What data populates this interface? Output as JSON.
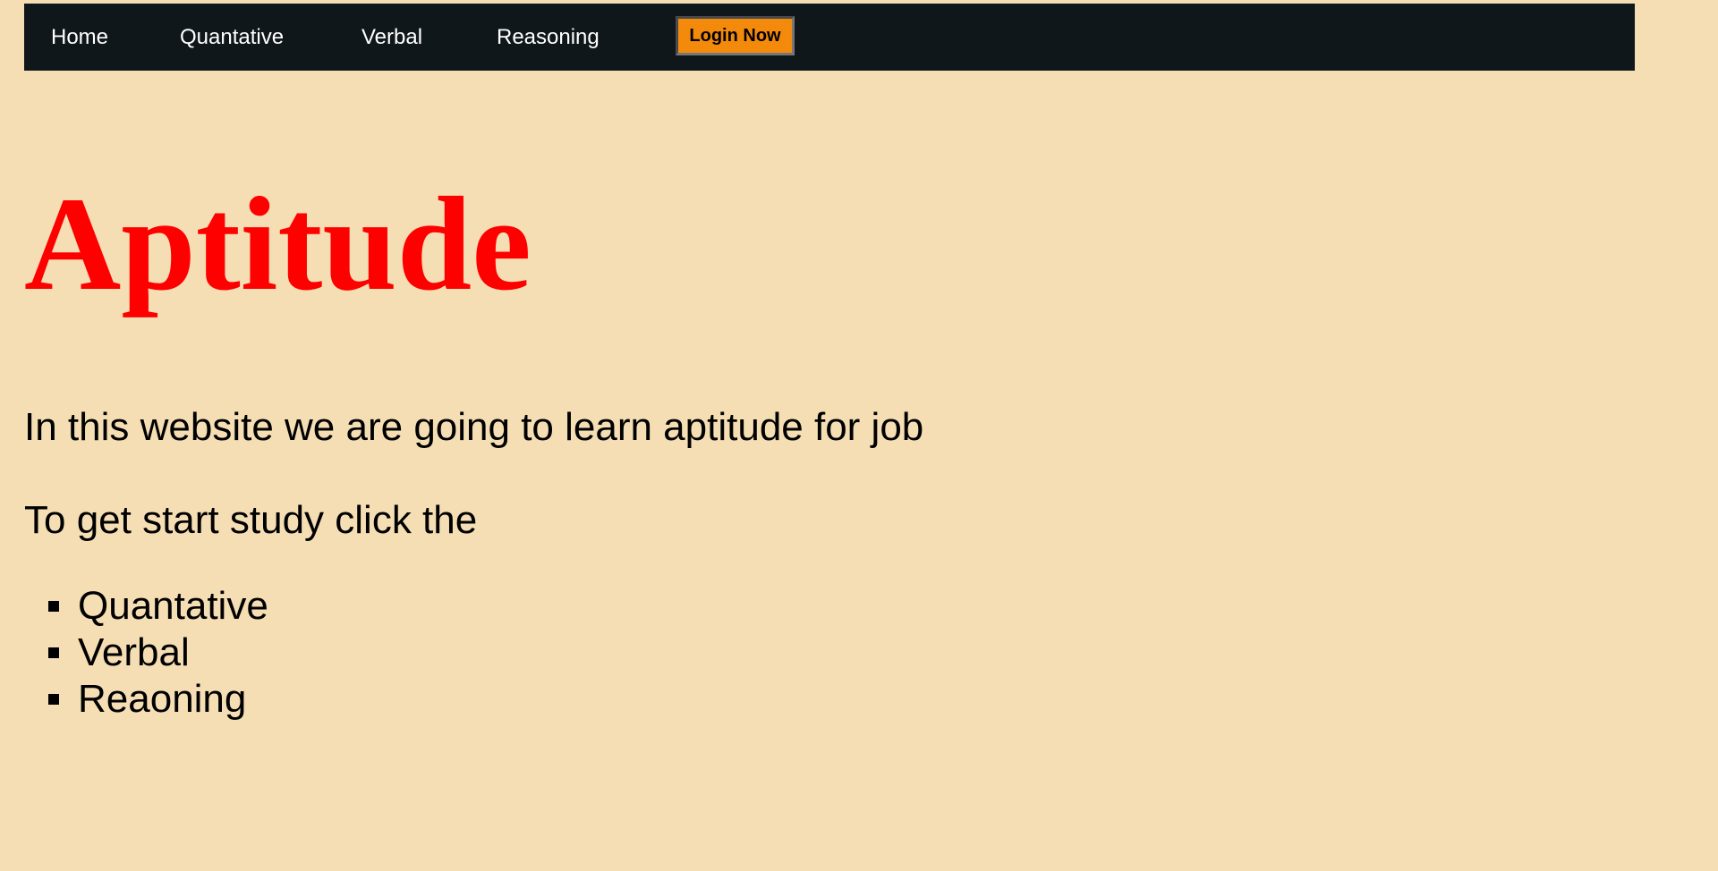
{
  "nav": {
    "items": [
      {
        "label": "Home"
      },
      {
        "label": "Quantative"
      },
      {
        "label": "Verbal"
      },
      {
        "label": "Reasoning"
      }
    ],
    "login_label": "Login Now"
  },
  "main": {
    "title": "Aptitude",
    "intro": "In this website we are going to learn aptitude for job",
    "prompt": "To get start study click the",
    "topics": [
      {
        "label": "Quantative"
      },
      {
        "label": "Verbal"
      },
      {
        "label": "Reaoning"
      }
    ]
  },
  "colors": {
    "background": "#f5deb3",
    "navbar": "#0f171b",
    "title": "#ff0000",
    "login_button": "#f48a0c"
  },
  "icons": {
    "list_bullet": "square-bullet-icon"
  }
}
